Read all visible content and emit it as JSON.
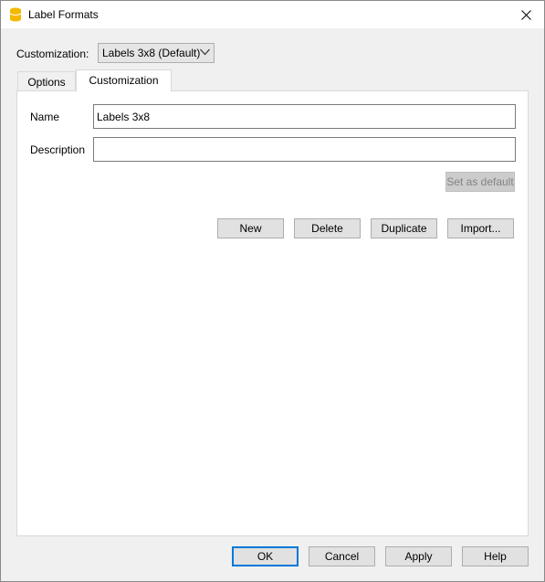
{
  "window": {
    "title": "Label Formats",
    "icon": "database-icon",
    "close_icon": "close-icon"
  },
  "customization": {
    "label": "Customization:",
    "selected": "Labels 3x8 (Default)"
  },
  "tabs": [
    {
      "label": "Options",
      "active": false
    },
    {
      "label": "Customization",
      "active": true
    }
  ],
  "form": {
    "name_label": "Name",
    "name_value": "Labels 3x8",
    "description_label": "Description",
    "description_value": "",
    "set_default_label": "Set as default"
  },
  "actions": {
    "new": "New",
    "delete": "Delete",
    "duplicate": "Duplicate",
    "import": "Import..."
  },
  "footer": {
    "ok": "OK",
    "cancel": "Cancel",
    "apply": "Apply",
    "help": "Help"
  },
  "colors": {
    "accent": "#0078d7",
    "icon_yellow": "#f5b800"
  }
}
